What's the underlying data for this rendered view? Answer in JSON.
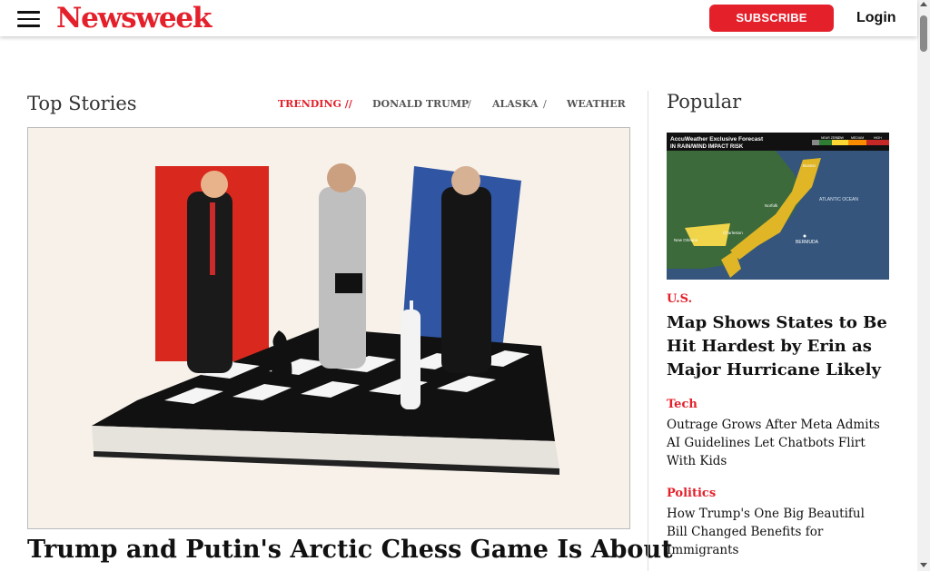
{
  "header": {
    "logo": "Newsweek",
    "subscribe_label": "SUBSCRIBE",
    "login_label": "Login",
    "accent_color": "#e4202b"
  },
  "top_stories": {
    "title": "Top Stories",
    "trending_label": "TRENDING //",
    "trending_links": [
      "DONALD TRUMP",
      "ALASKA",
      "WEATHER"
    ],
    "separator": "/",
    "hero_image_description": "chess-board-collage",
    "headline": "Trump and Putin's Arctic Chess Game Is About"
  },
  "popular": {
    "title": "Popular",
    "map_image": {
      "banner": "AccuWeather Exclusive Forecast",
      "subtitle": "IN RAIN/WIND IMPACT RISK",
      "legend": [
        "NEAR ZERO",
        "LOW",
        "MEDIUM",
        "HIGH"
      ],
      "labels": [
        "ATLANTIC OCEAN",
        "BERMUDA",
        "Norfolk",
        "Boston",
        "Charleston",
        "New Orleans"
      ]
    },
    "items": [
      {
        "category": "U.S.",
        "headline": "Map Shows States to Be Hit Hardest by Erin as Major Hurricane Likely"
      },
      {
        "category": "Tech",
        "headline": "Outrage Grows After Meta Admits AI Guidelines Let Chatbots Flirt With Kids"
      },
      {
        "category": "Politics",
        "headline": "How Trump's One Big Beautiful Bill Changed Benefits for Immigrants"
      }
    ]
  }
}
